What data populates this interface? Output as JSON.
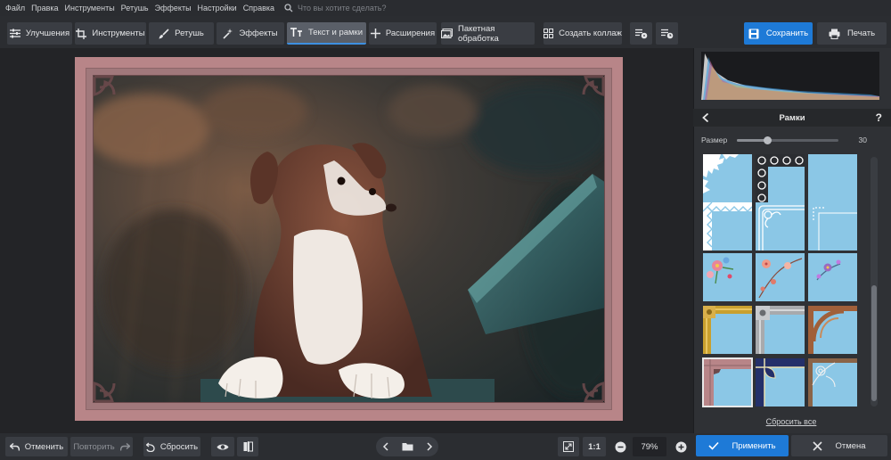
{
  "menu": {
    "items": [
      "Файл",
      "Правка",
      "Инструменты",
      "Ретушь",
      "Эффекты",
      "Настройки",
      "Справка"
    ],
    "search_placeholder": "Что вы хотите сделать?"
  },
  "toolbar": {
    "tabs": [
      "Улучшения",
      "Инструменты",
      "Ретушь",
      "Эффекты",
      "Текст и рамки",
      "Расширения"
    ],
    "active_tab": "Текст и рамки",
    "batch": "Пакетная обработка",
    "collage": "Создать коллаж",
    "save": "Сохранить",
    "print": "Печать"
  },
  "panel": {
    "title": "Рамки",
    "back_icon": "chevron-left-icon",
    "help": "?",
    "size_label": "Размер",
    "size_value": "30",
    "size_max": "100",
    "reset_all": "Сбросить все",
    "frames": [
      "white-lace",
      "white-swirl",
      "cyan-plain",
      "white-diamond",
      "white-corner-ornament",
      "white-dotted-corner",
      "floral-pink",
      "floral-peach",
      "floral-purple",
      "gold-baroque",
      "silver-ornate",
      "brown-curl",
      "pink-classic",
      "navy-ornate",
      "silver-lace"
    ],
    "selected_frame": "pink-classic"
  },
  "bottom": {
    "undo": "Отменить",
    "redo": "Повторить",
    "reset": "Сбросить",
    "ratio": "1:1",
    "zoom": "79%",
    "apply": "Применить",
    "cancel": "Отмена"
  },
  "colors": {
    "accent": "#1e7ad7",
    "frame": "#b88588",
    "thumb_bg": "#8bc7e6"
  }
}
